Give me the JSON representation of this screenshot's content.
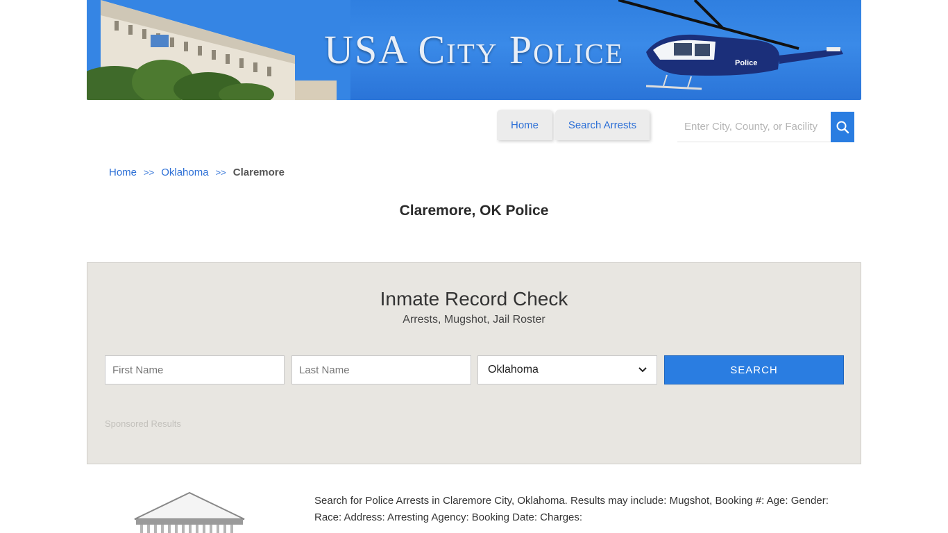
{
  "banner": {
    "title": "USA City Police",
    "heli_label": "Police"
  },
  "nav": {
    "items": [
      "Home",
      "Search Arrests"
    ]
  },
  "search": {
    "placeholder": "Enter City, County, or Facility"
  },
  "breadcrumb": {
    "home": "Home",
    "sep": ">>",
    "state": "Oklahoma",
    "current": "Claremore"
  },
  "page_title": "Claremore, OK Police",
  "panel": {
    "title": "Inmate Record Check",
    "subtitle": "Arrests, Mugshot, Jail Roster",
    "first_name_placeholder": "First Name",
    "last_name_placeholder": "Last Name",
    "state_selected": "Oklahoma",
    "submit_label": "SEARCH",
    "sponsored": "Sponsored Results"
  },
  "description": "Search for Police Arrests in Claremore City, Oklahoma. Results may include: Mugshot, Booking #: Age: Gender: Race: Address: Arresting Agency: Booking Date: Charges:",
  "colors": {
    "accent": "#2a7de1",
    "link": "#2c6fd6",
    "panel_bg": "#e8e6e1"
  }
}
